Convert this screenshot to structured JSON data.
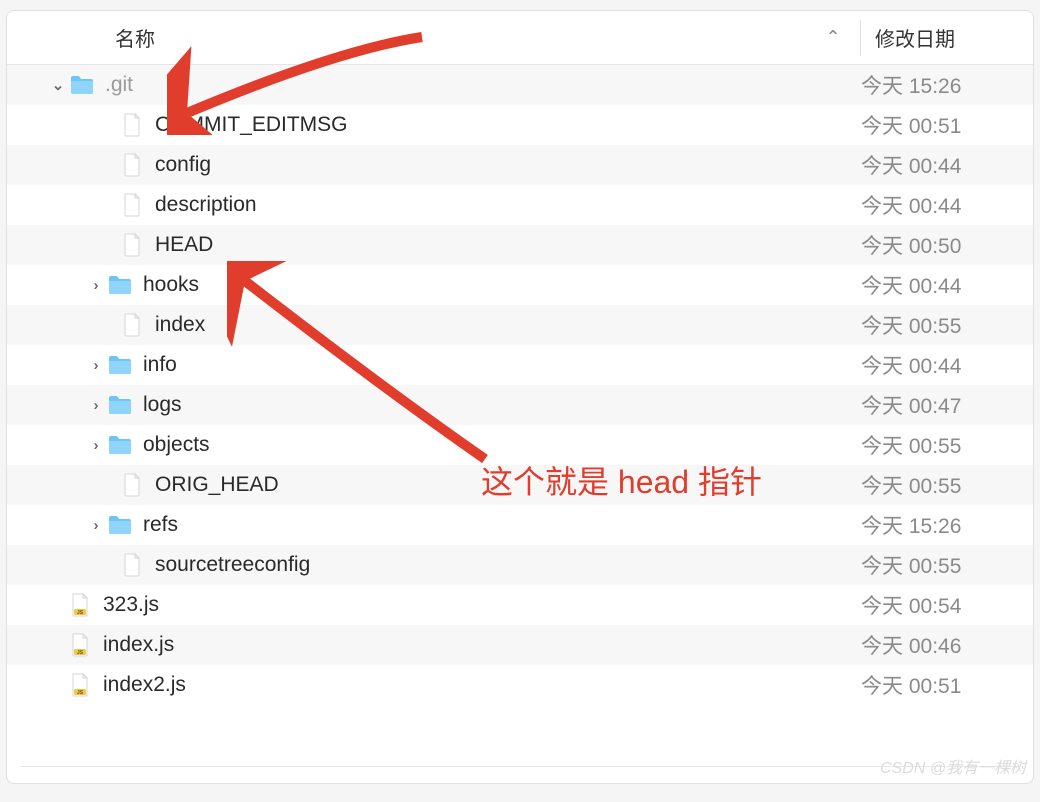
{
  "header": {
    "name_label": "名称",
    "date_label": "修改日期",
    "sort_glyph": "⌃"
  },
  "rows": [
    {
      "type": "folder",
      "name": ".git",
      "date": "今天 15:26",
      "indent": 0,
      "expanded": true,
      "dim": true,
      "alt": true
    },
    {
      "type": "file",
      "name": "COMMIT_EDITMSG",
      "date": "今天 00:51",
      "indent": 1,
      "alt": false
    },
    {
      "type": "file",
      "name": "config",
      "date": "今天 00:44",
      "indent": 1,
      "alt": true
    },
    {
      "type": "file",
      "name": "description",
      "date": "今天 00:44",
      "indent": 1,
      "alt": false
    },
    {
      "type": "file",
      "name": "HEAD",
      "date": "今天 00:50",
      "indent": 1,
      "alt": true
    },
    {
      "type": "folder",
      "name": "hooks",
      "date": "今天 00:44",
      "indent": 1,
      "expanded": false,
      "alt": false
    },
    {
      "type": "file",
      "name": "index",
      "date": "今天 00:55",
      "indent": 1,
      "alt": true
    },
    {
      "type": "folder",
      "name": "info",
      "date": "今天 00:44",
      "indent": 1,
      "expanded": false,
      "alt": false
    },
    {
      "type": "folder",
      "name": "logs",
      "date": "今天 00:47",
      "indent": 1,
      "expanded": false,
      "alt": true
    },
    {
      "type": "folder",
      "name": "objects",
      "date": "今天 00:55",
      "indent": 1,
      "expanded": false,
      "alt": false
    },
    {
      "type": "file",
      "name": "ORIG_HEAD",
      "date": "今天 00:55",
      "indent": 1,
      "alt": true
    },
    {
      "type": "folder",
      "name": "refs",
      "date": "今天 15:26",
      "indent": 1,
      "expanded": false,
      "alt": false
    },
    {
      "type": "file",
      "name": "sourcetreeconfig",
      "date": "今天 00:55",
      "indent": 1,
      "alt": true
    },
    {
      "type": "js",
      "name": "323.js",
      "date": "今天 00:54",
      "indent": 2,
      "alt": false
    },
    {
      "type": "js",
      "name": "index.js",
      "date": "今天 00:46",
      "indent": 2,
      "alt": true
    },
    {
      "type": "js",
      "name": "index2.js",
      "date": "今天 00:51",
      "indent": 2,
      "alt": false
    }
  ],
  "annotation": {
    "text": "这个就是 head 指针"
  },
  "watermark": "CSDN @我有一棵树"
}
